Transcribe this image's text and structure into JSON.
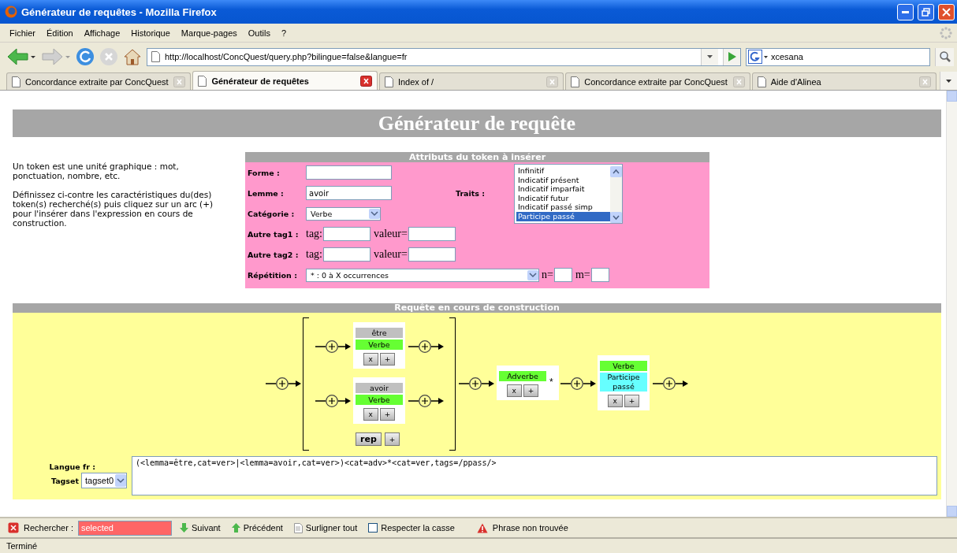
{
  "window": {
    "title": "Générateur de requêtes - Mozilla Firefox"
  },
  "menu": [
    "Fichier",
    "Édition",
    "Affichage",
    "Historique",
    "Marque-pages",
    "Outils",
    "?"
  ],
  "nav": {
    "url": "http://localhost/ConcQuest/query.php?bilingue=false&langue=fr",
    "search": "xcesana"
  },
  "tabs": [
    {
      "label": "Concordance extraite par ConcQuest",
      "selected": false
    },
    {
      "label": "Générateur de requêtes",
      "selected": true
    },
    {
      "label": "Index of /",
      "selected": false
    },
    {
      "label": "Concordance extraite par ConcQuest",
      "selected": false
    },
    {
      "label": "Aide d'Alinea",
      "selected": false
    }
  ],
  "page": {
    "title": "Générateur de requête",
    "intro": [
      "Un token est une unité graphique : mot, ponctuation, nombre, etc.",
      "Définissez ci-contre les caractéristiques du(des) token(s) recherché(s) puis cliquez sur un arc (+) pour l'insérer dans l'expression en cours de construction."
    ],
    "form": {
      "header": "Attributs du token à insérer",
      "forme": {
        "label": "Forme :"
      },
      "lemme": {
        "label": "Lemme :",
        "value": "avoir"
      },
      "categorie": {
        "label": "Catégorie :",
        "value": "Verbe"
      },
      "traits": {
        "label": "Traits :",
        "options": [
          {
            "label": "Infinitif",
            "selected": false
          },
          {
            "label": "Indicatif présent",
            "selected": false
          },
          {
            "label": "Indicatif imparfait",
            "selected": false
          },
          {
            "label": "Indicatif futur",
            "selected": false
          },
          {
            "label": "Indicatif passé simp",
            "selected": false
          },
          {
            "label": "Participe passé",
            "selected": true
          }
        ]
      },
      "other_tags": [
        {
          "label": "Autre tag1 :",
          "tag_label": "tag:",
          "value_label": "valeur="
        },
        {
          "label": "Autre tag2 :",
          "tag_label": "tag:",
          "value_label": "valeur="
        }
      ],
      "repetition": {
        "label": "Répétition :",
        "value": "* : 0 à X occurrences",
        "n_label": "n=",
        "m_label": "m="
      }
    },
    "query": {
      "header": "Requête en cours de construction",
      "group": {
        "branches": [
          {
            "lemma": "être",
            "category": "Verbe",
            "buttons": [
              "x",
              "+"
            ]
          },
          {
            "lemma": "avoir",
            "category": "Verbe",
            "buttons": [
              "x",
              "+"
            ]
          }
        ],
        "buttons": [
          "rep",
          "+"
        ]
      },
      "tokens": [
        {
          "category": "Adverbe",
          "repeat": "*",
          "buttons": [
            "x",
            "+"
          ]
        },
        {
          "category": "Verbe",
          "traits": "Participe passé",
          "buttons": [
            "x",
            "+"
          ]
        }
      ],
      "language_label": "Langue fr :",
      "tagset_label": "Tagset",
      "tagset": "tagset0",
      "expression": "(<lemma=être,cat=ver>|<lemma=avoir,cat=ver>)<cat=adv>*<cat=ver,tags=/ppass/>"
    }
  },
  "find_bar": {
    "label": "Rechercher :",
    "value": "selected",
    "not_found": true,
    "buttons": [
      "Suivant",
      "Précédent",
      "Surligner tout"
    ],
    "match_case": {
      "label": "Respecter la casse",
      "checked": false
    },
    "message": "Phrase non trouvée"
  },
  "status": "Terminé"
}
